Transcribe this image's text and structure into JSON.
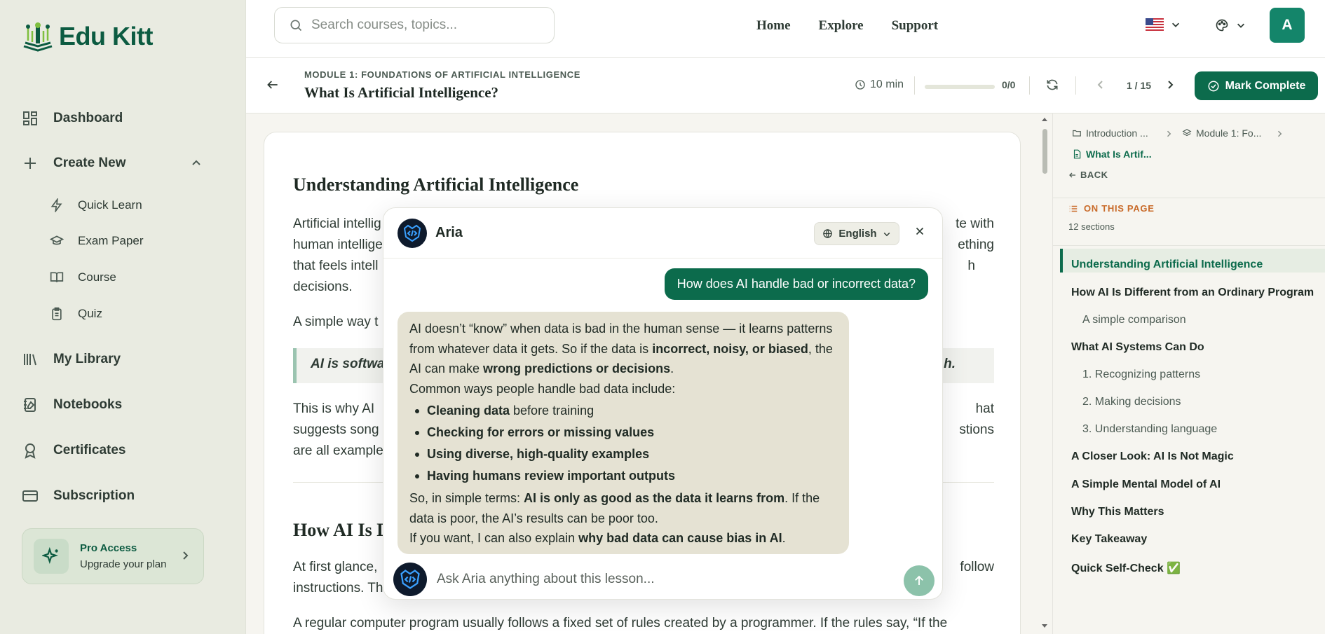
{
  "brand": {
    "name": "Edu Kitt",
    "color": "#0c5b41"
  },
  "sidebar": {
    "items": [
      {
        "label": "Dashboard",
        "icon": "dashboard-icon"
      },
      {
        "label": "Create New",
        "icon": "plus-icon"
      },
      {
        "label": "My Library",
        "icon": "library-icon"
      },
      {
        "label": "Notebooks",
        "icon": "notebook-icon"
      },
      {
        "label": "Certificates",
        "icon": "certificate-icon"
      },
      {
        "label": "Subscription",
        "icon": "credit-card-icon"
      }
    ],
    "create_sub": [
      {
        "label": "Quick Learn",
        "icon": "zap-icon"
      },
      {
        "label": "Exam Paper",
        "icon": "graduation-cap-icon"
      },
      {
        "label": "Course",
        "icon": "book-open-icon"
      },
      {
        "label": "Quiz",
        "icon": "clipboard-icon"
      }
    ],
    "pro": {
      "title": "Pro Access",
      "subtitle": "Upgrade your plan"
    }
  },
  "header": {
    "search_placeholder": "Search courses, topics...",
    "nav": [
      "Home",
      "Explore",
      "Support"
    ],
    "avatar_letter": "A"
  },
  "lesson": {
    "module": "MODULE 1: FOUNDATIONS OF ARTIFICIAL INTELLIGENCE",
    "title": "What Is Artificial Intelligence?",
    "time": "10 min",
    "progress_count": "0/0",
    "progress_fraction": 0,
    "page": "1 / 15",
    "mark_complete": "Mark Complete"
  },
  "content": {
    "h1": "Understanding Artificial Intelligence",
    "p1_left": "Artificial intellig",
    "p1_line2_left": "human intellige",
    "p1_line3_left": "that feels intell",
    "p1_line4": "decisions.",
    "p1_right1": "te with",
    "p1_right2": "ething",
    "p1_right3": "h",
    "p2_left": "A simple way t",
    "quote_left": "AI is softwa",
    "quote_right": "h.",
    "p3_line1_left": "This is why AI",
    "p3_line1_right": "hat",
    "p3_line2_left": "suggests song",
    "p3_line2_right": "stions",
    "p3_line3_left": "are all example",
    "h2": "How AI Is D",
    "p4_line1_left": "At first glance,",
    "p4_line1_right": "follow",
    "p4_line2_left": "instructions. Th",
    "p5": "A regular computer program usually follows a fixed set of rules created by a programmer. If the rules say, “If the"
  },
  "panel": {
    "crumbs": [
      "Introduction ...",
      "Module 1: Fo...",
      "What Is Artif..."
    ],
    "back": "BACK",
    "on_this_page": "ON THIS PAGE",
    "sections": "12 sections",
    "toc": [
      {
        "label": "Understanding Artificial Intelligence",
        "level": 1,
        "active": true
      },
      {
        "label": "How AI Is Different from an Ordinary Program",
        "level": 1
      },
      {
        "label": "A simple comparison",
        "level": 2
      },
      {
        "label": "What AI Systems Can Do",
        "level": 1
      },
      {
        "label": "1. Recognizing patterns",
        "level": 2
      },
      {
        "label": "2. Making decisions",
        "level": 2
      },
      {
        "label": "3. Understanding language",
        "level": 2
      },
      {
        "label": "A Closer Look: AI Is Not Magic",
        "level": 1
      },
      {
        "label": "A Simple Mental Model of AI",
        "level": 1
      },
      {
        "label": "Why This Matters",
        "level": 1
      },
      {
        "label": "Key Takeaway",
        "level": 1
      },
      {
        "label": "Quick Self-Check ✅",
        "level": 1
      }
    ]
  },
  "chat": {
    "name": "Aria",
    "language": "English",
    "user_message": "How does AI handle bad or incorrect data?",
    "reply": {
      "p1a": "AI doesn’t “know” when data is bad in the human sense — it learns patterns from whatever data it gets. So if the data is ",
      "p1b": "incorrect, noisy, or biased",
      "p1c": ", the AI can make ",
      "p1d": "wrong predictions or decisions",
      "p1e": ".",
      "p2": "Common ways people handle bad data include:",
      "b1a": "Cleaning data",
      "b1b": " before training",
      "b2": "Checking for errors or missing values",
      "b3": "Using diverse, high-quality examples",
      "b4": "Having humans review important outputs",
      "p3a": "So, in simple terms: ",
      "p3b": "AI is only as good as the data it learns from",
      "p3c": ". If the data is poor, the AI’s results can be poor too.",
      "p4a": "If you want, I can also explain ",
      "p4b": "why bad data can cause bias in AI",
      "p4c": "."
    },
    "input_placeholder": "Ask Aria anything about this lesson..."
  }
}
